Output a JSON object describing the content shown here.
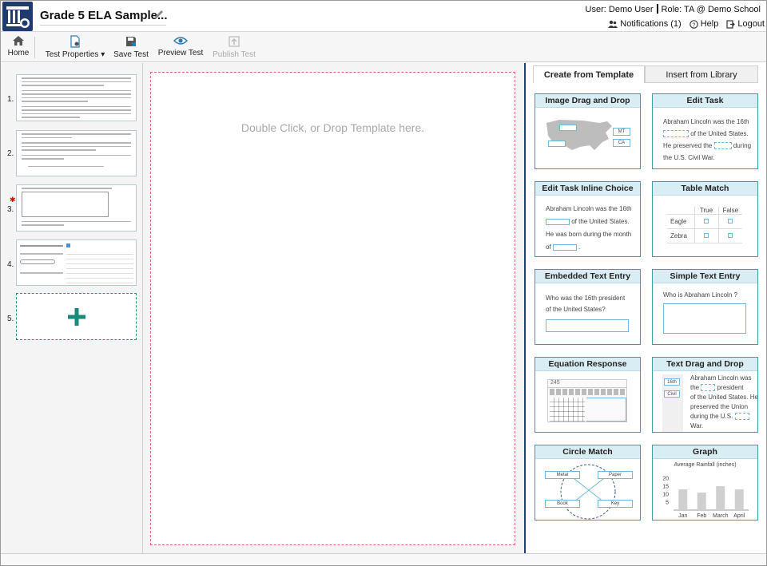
{
  "header": {
    "title": "Grade 5 ELA Sample...",
    "user_label": "User: Demo User",
    "role_label": "Role: TA @ Demo School",
    "notifications": "Notifications (1)",
    "help": "Help",
    "logout": "Logout"
  },
  "toolbar": {
    "home": "Home",
    "test_properties": "Test Properties",
    "save_test": "Save Test",
    "preview_test": "Preview Test",
    "publish_test": "Publish Test"
  },
  "items": {
    "n1": "1.",
    "n2": "2.",
    "n3": "3.",
    "n4": "4.",
    "n5": "5."
  },
  "canvas": {
    "drop_text": "Double Click, or Drop Template here."
  },
  "tabs": {
    "create": "Create from Template",
    "insert": "Insert from Library"
  },
  "templates": {
    "image_drag_drop": {
      "title": "Image Drag and Drop",
      "mt": "MT",
      "ca": "CA"
    },
    "edit_task": {
      "title": "Edit Task",
      "l1": "Abraham Lincoln was the 16th",
      "l2": "of the United States.",
      "l3": "He preserved the",
      "l4": "during",
      "l5": "the U.S. Civil War."
    },
    "edit_task_inline": {
      "title": "Edit Task Inline Choice",
      "l1": "Abraham Lincoln was the 16th",
      "l2": "of the United States.",
      "l3": "He was born during the month",
      "l4": "of"
    },
    "table_match": {
      "title": "Table Match",
      "col1": "True",
      "col2": "False",
      "row1": "Eagle",
      "row2": "Zebra"
    },
    "embedded_text": {
      "title": "Embedded Text Entry",
      "prompt": "Who was the 16th president of the United States?"
    },
    "simple_text": {
      "title": "Simple Text Entry",
      "prompt": "Who is Abraham Lincoln ?"
    },
    "equation": {
      "title": "Equation Response",
      "value": "245"
    },
    "text_drag": {
      "title": "Text Drag and Drop",
      "t1": "16th",
      "t2": "Civil",
      "l1": "Abraham Lincoln was",
      "l2": "the",
      "l3": "president",
      "l4": "of the United States. He",
      "l5": "preserved the Union",
      "l6": "during the U.S.",
      "l7": "War."
    },
    "circle_match": {
      "title": "Circle Match",
      "a": "Metal",
      "b": "Paper",
      "c": "Book",
      "d": "Key"
    },
    "graph": {
      "title": "Graph",
      "chart_title": "Average Rainfall (inches)"
    }
  },
  "chart_data": {
    "type": "bar",
    "title": "Average Rainfall (inches)",
    "categories": [
      "Jan",
      "Feb",
      "March",
      "April"
    ],
    "values": [
      13,
      11,
      15,
      13
    ],
    "yticks": [
      "20",
      "15",
      "10",
      "5"
    ],
    "ylim": [
      0,
      20
    ]
  }
}
